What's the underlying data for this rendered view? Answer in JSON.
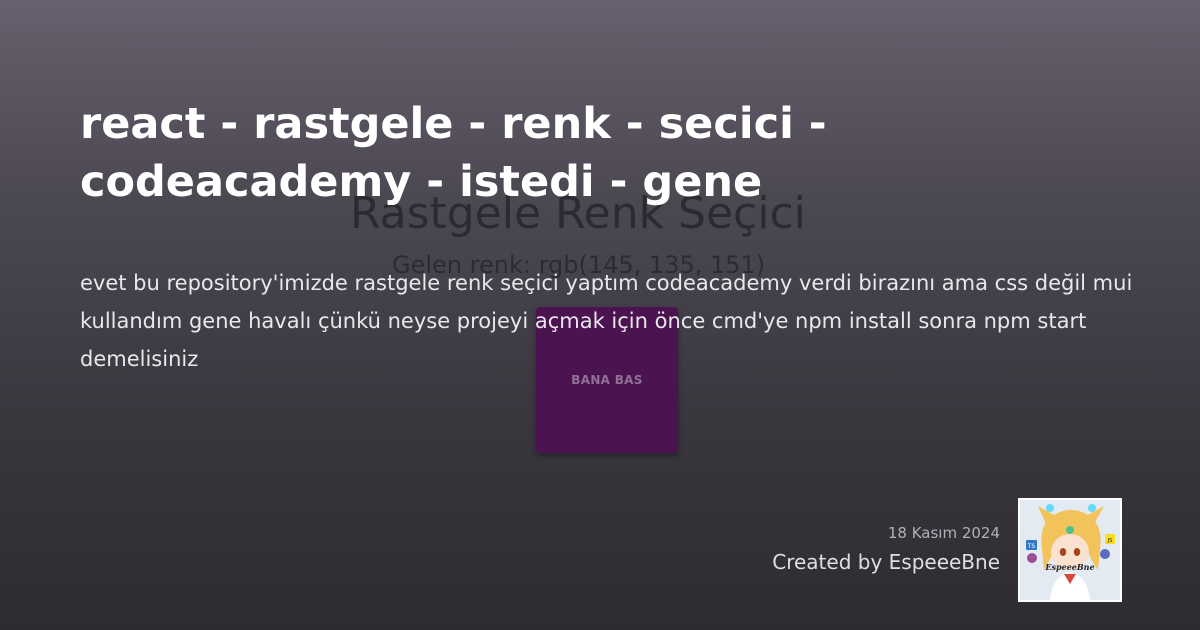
{
  "card": {
    "title": "react - rastgele - renk - secici - codeacademy - istedi - gene",
    "description": "evet bu repository'imizde rastgele renk seçici yaptım codeacademy verdi birazını ama css değil mui kullandım gene havalı çünkü neyse projeyi açmak için önce cmd'ye npm install sonra npm start demelisiniz",
    "date": "18 Kasım 2024",
    "author": "Created by EspeeeBne"
  },
  "background_preview": {
    "app_title": "Rastgele Renk Seçici",
    "color_text": "Gelen renk: rgb(145, 135, 151)",
    "button_label": "BANA BAS",
    "button_color": "#4b1450"
  },
  "avatar": {
    "signature": "EspeeeBne",
    "badges": [
      "TS",
      "JS"
    ],
    "icon": "anime-avatar-icon"
  },
  "colors": {
    "background_top": "#67606e",
    "background_bottom": "#2e2c31",
    "title": "#ffffff",
    "description": "#e9e7ec"
  }
}
